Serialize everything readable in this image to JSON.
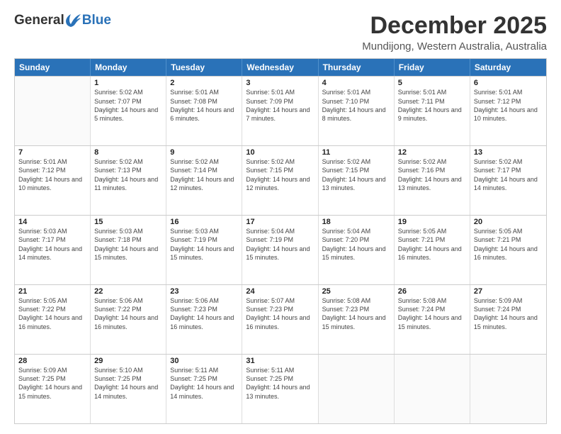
{
  "header": {
    "logo_line1": "General",
    "logo_line2": "Blue",
    "title": "December 2025",
    "subtitle": "Mundijong, Western Australia, Australia"
  },
  "days_of_week": [
    "Sunday",
    "Monday",
    "Tuesday",
    "Wednesday",
    "Thursday",
    "Friday",
    "Saturday"
  ],
  "weeks": [
    [
      {
        "day": "",
        "empty": true
      },
      {
        "day": "1",
        "sunrise": "5:02 AM",
        "sunset": "7:07 PM",
        "daylight": "14 hours and 5 minutes."
      },
      {
        "day": "2",
        "sunrise": "5:01 AM",
        "sunset": "7:08 PM",
        "daylight": "14 hours and 6 minutes."
      },
      {
        "day": "3",
        "sunrise": "5:01 AM",
        "sunset": "7:09 PM",
        "daylight": "14 hours and 7 minutes."
      },
      {
        "day": "4",
        "sunrise": "5:01 AM",
        "sunset": "7:10 PM",
        "daylight": "14 hours and 8 minutes."
      },
      {
        "day": "5",
        "sunrise": "5:01 AM",
        "sunset": "7:11 PM",
        "daylight": "14 hours and 9 minutes."
      },
      {
        "day": "6",
        "sunrise": "5:01 AM",
        "sunset": "7:12 PM",
        "daylight": "14 hours and 10 minutes."
      }
    ],
    [
      {
        "day": "7",
        "sunrise": "5:01 AM",
        "sunset": "7:12 PM",
        "daylight": "14 hours and 10 minutes."
      },
      {
        "day": "8",
        "sunrise": "5:02 AM",
        "sunset": "7:13 PM",
        "daylight": "14 hours and 11 minutes."
      },
      {
        "day": "9",
        "sunrise": "5:02 AM",
        "sunset": "7:14 PM",
        "daylight": "14 hours and 12 minutes."
      },
      {
        "day": "10",
        "sunrise": "5:02 AM",
        "sunset": "7:15 PM",
        "daylight": "14 hours and 12 minutes."
      },
      {
        "day": "11",
        "sunrise": "5:02 AM",
        "sunset": "7:15 PM",
        "daylight": "14 hours and 13 minutes."
      },
      {
        "day": "12",
        "sunrise": "5:02 AM",
        "sunset": "7:16 PM",
        "daylight": "14 hours and 13 minutes."
      },
      {
        "day": "13",
        "sunrise": "5:02 AM",
        "sunset": "7:17 PM",
        "daylight": "14 hours and 14 minutes."
      }
    ],
    [
      {
        "day": "14",
        "sunrise": "5:03 AM",
        "sunset": "7:17 PM",
        "daylight": "14 hours and 14 minutes."
      },
      {
        "day": "15",
        "sunrise": "5:03 AM",
        "sunset": "7:18 PM",
        "daylight": "14 hours and 15 minutes."
      },
      {
        "day": "16",
        "sunrise": "5:03 AM",
        "sunset": "7:19 PM",
        "daylight": "14 hours and 15 minutes."
      },
      {
        "day": "17",
        "sunrise": "5:04 AM",
        "sunset": "7:19 PM",
        "daylight": "14 hours and 15 minutes."
      },
      {
        "day": "18",
        "sunrise": "5:04 AM",
        "sunset": "7:20 PM",
        "daylight": "14 hours and 15 minutes."
      },
      {
        "day": "19",
        "sunrise": "5:05 AM",
        "sunset": "7:21 PM",
        "daylight": "14 hours and 16 minutes."
      },
      {
        "day": "20",
        "sunrise": "5:05 AM",
        "sunset": "7:21 PM",
        "daylight": "14 hours and 16 minutes."
      }
    ],
    [
      {
        "day": "21",
        "sunrise": "5:05 AM",
        "sunset": "7:22 PM",
        "daylight": "14 hours and 16 minutes."
      },
      {
        "day": "22",
        "sunrise": "5:06 AM",
        "sunset": "7:22 PM",
        "daylight": "14 hours and 16 minutes."
      },
      {
        "day": "23",
        "sunrise": "5:06 AM",
        "sunset": "7:23 PM",
        "daylight": "14 hours and 16 minutes."
      },
      {
        "day": "24",
        "sunrise": "5:07 AM",
        "sunset": "7:23 PM",
        "daylight": "14 hours and 16 minutes."
      },
      {
        "day": "25",
        "sunrise": "5:08 AM",
        "sunset": "7:23 PM",
        "daylight": "14 hours and 15 minutes."
      },
      {
        "day": "26",
        "sunrise": "5:08 AM",
        "sunset": "7:24 PM",
        "daylight": "14 hours and 15 minutes."
      },
      {
        "day": "27",
        "sunrise": "5:09 AM",
        "sunset": "7:24 PM",
        "daylight": "14 hours and 15 minutes."
      }
    ],
    [
      {
        "day": "28",
        "sunrise": "5:09 AM",
        "sunset": "7:25 PM",
        "daylight": "14 hours and 15 minutes."
      },
      {
        "day": "29",
        "sunrise": "5:10 AM",
        "sunset": "7:25 PM",
        "daylight": "14 hours and 14 minutes."
      },
      {
        "day": "30",
        "sunrise": "5:11 AM",
        "sunset": "7:25 PM",
        "daylight": "14 hours and 14 minutes."
      },
      {
        "day": "31",
        "sunrise": "5:11 AM",
        "sunset": "7:25 PM",
        "daylight": "14 hours and 13 minutes."
      },
      {
        "day": "",
        "empty": true
      },
      {
        "day": "",
        "empty": true
      },
      {
        "day": "",
        "empty": true
      }
    ]
  ]
}
